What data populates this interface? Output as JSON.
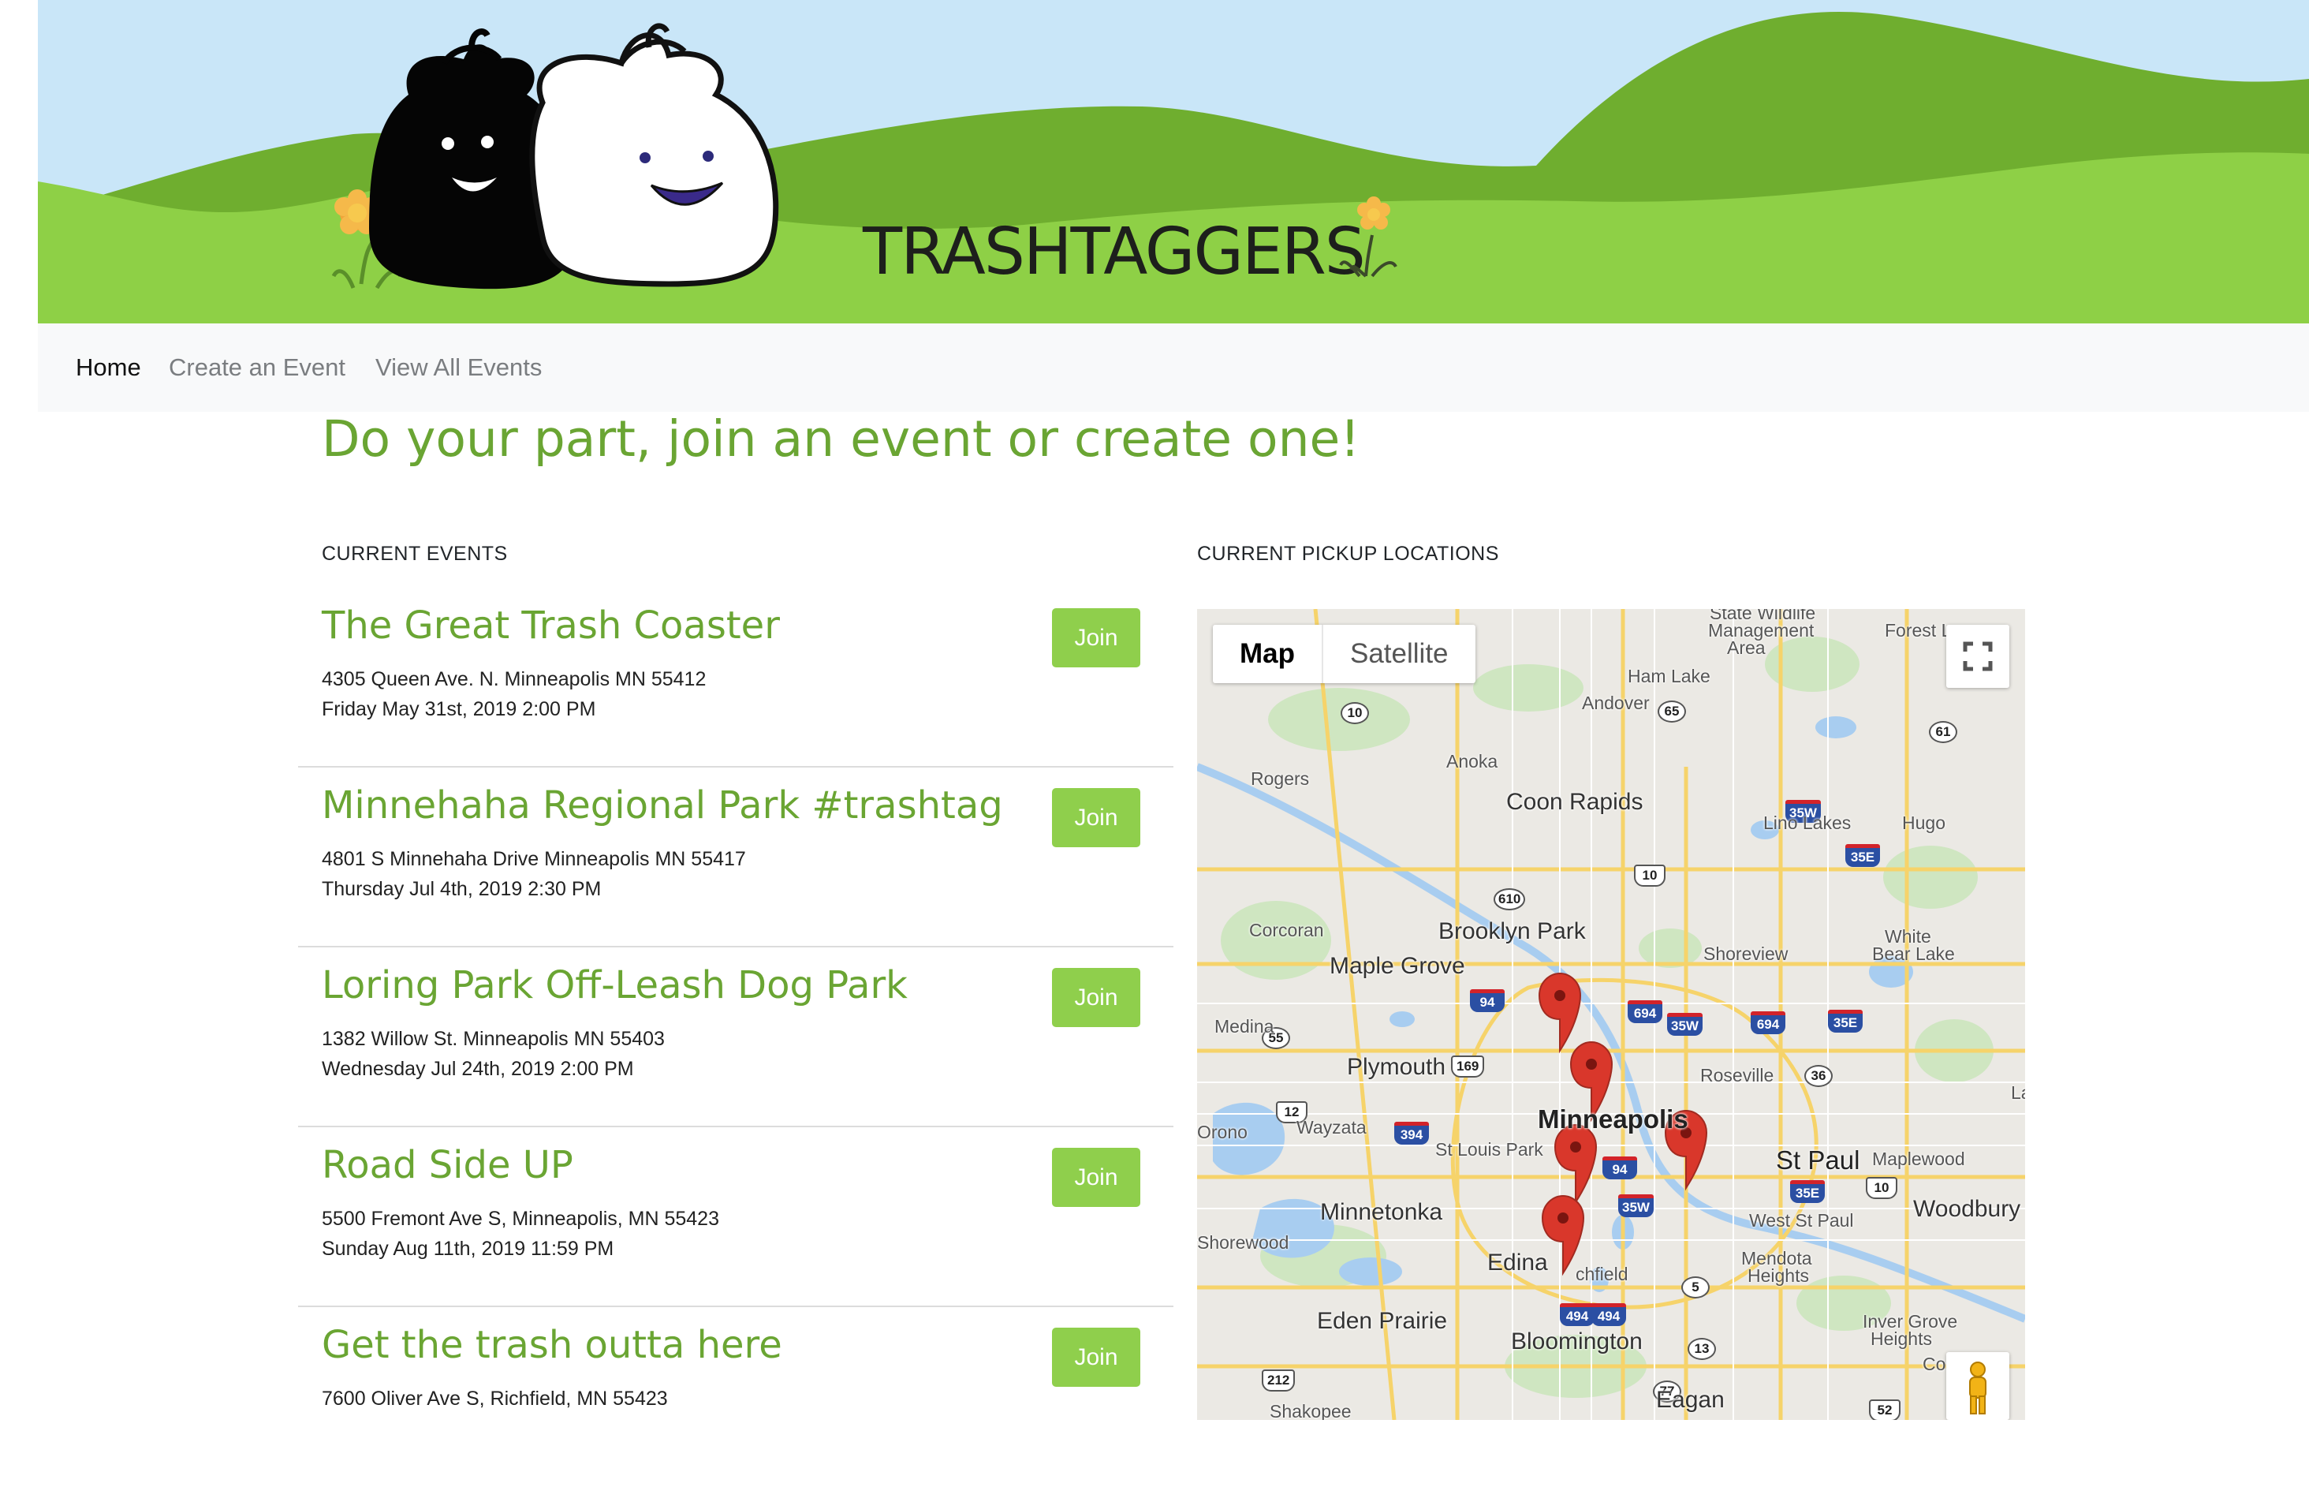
{
  "brand": {
    "title": "TRASHTAGGERS"
  },
  "nav": {
    "items": [
      {
        "label": "Home",
        "active": true
      },
      {
        "label": "Create an Event",
        "active": false
      },
      {
        "label": "View All Events",
        "active": false
      }
    ]
  },
  "page": {
    "tagline": "Do your part, join an event or create one!",
    "events_label": "CURRENT EVENTS",
    "map_label": "CURRENT PICKUP LOCATIONS"
  },
  "events": [
    {
      "title": "The Great Trash Coaster",
      "address": "4305 Queen Ave. N. Minneapolis MN 55412",
      "date": "Friday May 31st, 2019 2:00 PM",
      "button": "Join"
    },
    {
      "title": "Minnehaha Regional Park #trashtag",
      "address": "4801 S Minnehaha Drive Minneapolis MN 55417",
      "date": "Thursday Jul 4th, 2019 2:30 PM",
      "button": "Join"
    },
    {
      "title": "Loring Park Off-Leash Dog Park",
      "address": "1382 Willow St. Minneapolis MN 55403",
      "date": "Wednesday Jul 24th, 2019 2:00 PM",
      "button": "Join"
    },
    {
      "title": "Road Side UP",
      "address": "5500 Fremont Ave S, Minneapolis, MN 55423",
      "date": "Sunday Aug 11th, 2019 11:59 PM",
      "button": "Join"
    },
    {
      "title": "Get the trash outta here",
      "address": "7600 Oliver Ave S, Richfield, MN 55423",
      "date": "",
      "button": "Join"
    }
  ],
  "map": {
    "type_buttons": {
      "map": "Map",
      "satellite": "Satellite"
    },
    "labels": {
      "wildlife": "State Wildlife",
      "management": "Management",
      "area": "Area",
      "forest_lake": "Forest L",
      "ham_lake": "Ham Lake",
      "andover": "Andover",
      "anoka": "Anoka",
      "rogers": "Rogers",
      "coon_rapids": "Coon Rapids",
      "lino_lakes": "Lino Lakes",
      "hugo": "Hugo",
      "corcoran": "Corcoran",
      "brooklyn_park": "Brooklyn Park",
      "white_bear_1": "White",
      "white_bear_2": "Bear Lake",
      "maple_grove": "Maple Grove",
      "shoreview": "Shoreview",
      "medina": "Medina",
      "plymouth": "Plymouth",
      "roseville": "Roseville",
      "orono": "Orono",
      "wayzata": "Wayzata",
      "minneapolis": "Minneapolis",
      "st_louis_park": "St Louis Park",
      "st_paul": "St Paul",
      "maplewood": "Maplewood",
      "la": "La",
      "west_st_paul": "West St Paul",
      "woodbury": "Woodbury",
      "minnetonka": "Minnetonka",
      "shorewood": "Shorewood",
      "edina": "Edina",
      "richfield": "chfield",
      "mendota_1": "Mendota",
      "mendota_2": "Heights",
      "eden_prairie": "Eden Prairie",
      "bloomington": "Bloomington",
      "inver_grove_1": "Inver Grove",
      "inver_grove_2": "Heights",
      "eagan": "Eagan",
      "shakopee": "Shakopee",
      "cottage": "Co"
    },
    "shields": [
      {
        "text": "65",
        "kind": "state"
      },
      {
        "text": "10",
        "kind": "state"
      },
      {
        "text": "61",
        "kind": "state"
      },
      {
        "text": "35W",
        "kind": "interstate"
      },
      {
        "text": "35E",
        "kind": "interstate"
      },
      {
        "text": "10",
        "kind": "us"
      },
      {
        "text": "610",
        "kind": "state"
      },
      {
        "text": "94",
        "kind": "interstate"
      },
      {
        "text": "694",
        "kind": "interstate"
      },
      {
        "text": "35W",
        "kind": "interstate"
      },
      {
        "text": "694",
        "kind": "interstate"
      },
      {
        "text": "35E",
        "kind": "interstate"
      },
      {
        "text": "55",
        "kind": "state"
      },
      {
        "text": "169",
        "kind": "us"
      },
      {
        "text": "36",
        "kind": "state"
      },
      {
        "text": "12",
        "kind": "us"
      },
      {
        "text": "394",
        "kind": "interstate"
      },
      {
        "text": "94",
        "kind": "interstate"
      },
      {
        "text": "35E",
        "kind": "interstate"
      },
      {
        "text": "10",
        "kind": "us"
      },
      {
        "text": "35W",
        "kind": "interstate"
      },
      {
        "text": "5",
        "kind": "state"
      },
      {
        "text": "494",
        "kind": "interstate"
      },
      {
        "text": "494",
        "kind": "interstate"
      },
      {
        "text": "212",
        "kind": "us"
      },
      {
        "text": "13",
        "kind": "state"
      },
      {
        "text": "77",
        "kind": "state"
      },
      {
        "text": "52",
        "kind": "us"
      }
    ],
    "markers": 5
  }
}
